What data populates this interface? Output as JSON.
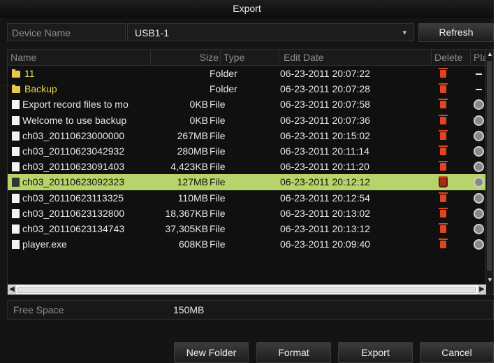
{
  "window": {
    "title": "Export"
  },
  "device": {
    "label": "Device Name",
    "value": "USB1-1",
    "refresh_label": "Refresh"
  },
  "table": {
    "headers": {
      "name": "Name",
      "size": "Size",
      "type": "Type",
      "edit_date": "Edit Date",
      "delete": "Delete",
      "play": "Pla"
    },
    "rows": [
      {
        "name": "11",
        "size": "",
        "type": "Folder",
        "date": "06-23-2011 20:07:22",
        "kind": "folder"
      },
      {
        "name": "Backup",
        "size": "",
        "type": "Folder",
        "date": "06-23-2011 20:07:28",
        "kind": "folder"
      },
      {
        "name": "Export record files to mo",
        "size": "0KB",
        "type": "File",
        "date": "06-23-2011 20:07:58",
        "kind": "file"
      },
      {
        "name": "Welcome to use backup",
        "size": "0KB",
        "type": "File",
        "date": "06-23-2011 20:07:36",
        "kind": "file"
      },
      {
        "name": "ch03_20110623000000",
        "size": "267MB",
        "type": "File",
        "date": "06-23-2011 20:15:02",
        "kind": "file"
      },
      {
        "name": "ch03_20110623042932",
        "size": "280MB",
        "type": "File",
        "date": "06-23-2011 20:11:14",
        "kind": "file"
      },
      {
        "name": "ch03_20110623091403",
        "size": "4,423KB",
        "type": "File",
        "date": "06-23-2011 20:11:20",
        "kind": "file"
      },
      {
        "name": "ch03_20110623092323",
        "size": "127MB",
        "type": "File",
        "date": "06-23-2011 20:12:12",
        "kind": "file",
        "selected": true
      },
      {
        "name": "ch03_20110623113325",
        "size": "110MB",
        "type": "File",
        "date": "06-23-2011 20:12:54",
        "kind": "file"
      },
      {
        "name": "ch03_20110623132800",
        "size": "18,367KB",
        "type": "File",
        "date": "06-23-2011 20:13:02",
        "kind": "file"
      },
      {
        "name": "ch03_20110623134743",
        "size": "37,305KB",
        "type": "File",
        "date": "06-23-2011 20:13:12",
        "kind": "file"
      },
      {
        "name": "player.exe",
        "size": "608KB",
        "type": "File",
        "date": "06-23-2011 20:09:40",
        "kind": "file"
      }
    ]
  },
  "free_space": {
    "label": "Free Space",
    "value": "150MB"
  },
  "buttons": {
    "new_folder": "New Folder",
    "format": "Format",
    "export": "Export",
    "cancel": "Cancel"
  },
  "colors": {
    "selected_row": "#b7d46a",
    "folder_text": "#e8d84a",
    "delete_icon": "#e04520"
  }
}
